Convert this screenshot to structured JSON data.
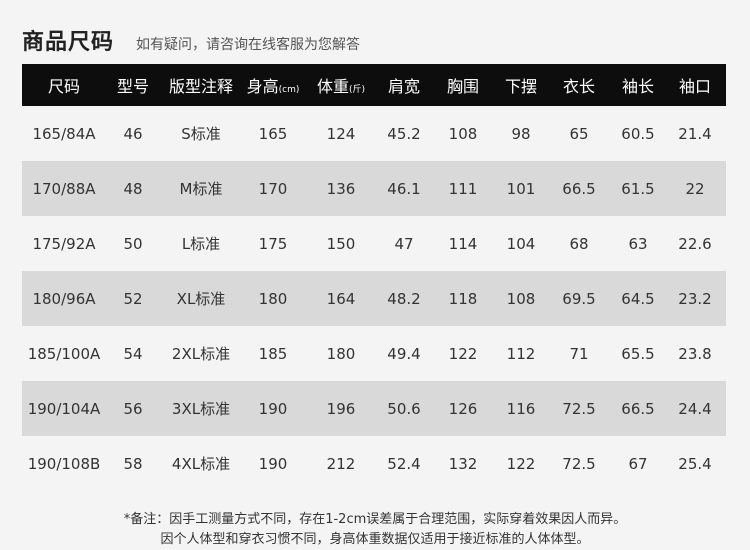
{
  "header": {
    "title": "商品尺码",
    "subtitle": "如有疑问，请咨询在线客服为您解答"
  },
  "table": {
    "columns": [
      {
        "label": "尺码",
        "unit": ""
      },
      {
        "label": "型号",
        "unit": ""
      },
      {
        "label": "版型注释",
        "unit": ""
      },
      {
        "label": "身高",
        "unit": "(cm)"
      },
      {
        "label": "体重",
        "unit": "(斤)"
      },
      {
        "label": "肩宽",
        "unit": ""
      },
      {
        "label": "胸围",
        "unit": ""
      },
      {
        "label": "下摆",
        "unit": ""
      },
      {
        "label": "衣长",
        "unit": ""
      },
      {
        "label": "袖长",
        "unit": ""
      },
      {
        "label": "袖口",
        "unit": ""
      }
    ],
    "rows": [
      [
        "165/84A",
        "46",
        "S标准",
        "165",
        "124",
        "45.2",
        "108",
        "98",
        "65",
        "60.5",
        "21.4"
      ],
      [
        "170/88A",
        "48",
        "M标准",
        "170",
        "136",
        "46.1",
        "111",
        "101",
        "66.5",
        "61.5",
        "22"
      ],
      [
        "175/92A",
        "50",
        "L标准",
        "175",
        "150",
        "47",
        "114",
        "104",
        "68",
        "63",
        "22.6"
      ],
      [
        "180/96A",
        "52",
        "XL标准",
        "180",
        "164",
        "48.2",
        "118",
        "108",
        "69.5",
        "64.5",
        "23.2"
      ],
      [
        "185/100A",
        "54",
        "2XL标准",
        "185",
        "180",
        "49.4",
        "122",
        "112",
        "71",
        "65.5",
        "23.8"
      ],
      [
        "190/104A",
        "56",
        "3XL标准",
        "190",
        "196",
        "50.6",
        "126",
        "116",
        "72.5",
        "66.5",
        "24.4"
      ],
      [
        "190/108B",
        "58",
        "4XL标准",
        "190",
        "212",
        "52.4",
        "132",
        "122",
        "72.5",
        "67",
        "25.4"
      ]
    ]
  },
  "notes": {
    "line1": "*备注：因手工测量方式不同，存在1-2cm误差属于合理范围，实际穿着效果因人而异。",
    "line2": "因个人体型和穿衣习惯不同，身高体重数据仅适用于接近标准的人体体型。"
  }
}
